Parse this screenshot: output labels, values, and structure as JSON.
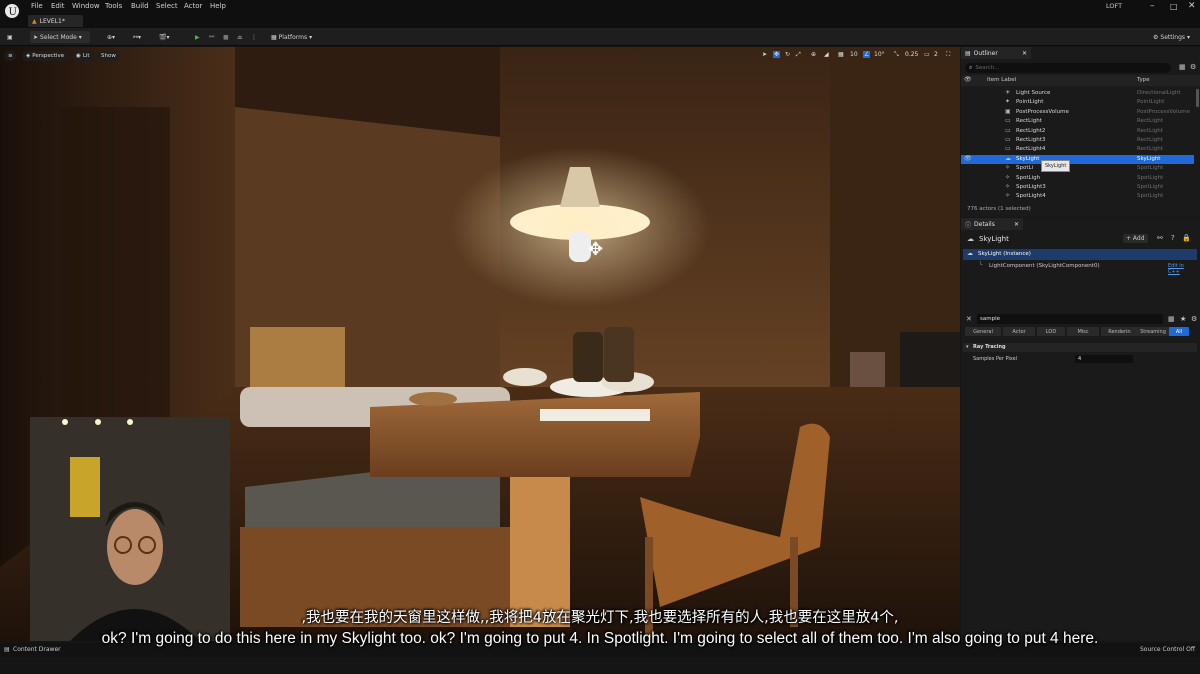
{
  "menu": [
    "File",
    "Edit",
    "Window",
    "Tools",
    "Build",
    "Select",
    "Actor",
    "Help"
  ],
  "level_tab": "LEVEL1*",
  "project_name": "LOFT",
  "toolbar": {
    "select_mode": "Select Mode",
    "platforms": "Platforms",
    "settings": "Settings"
  },
  "viewport": {
    "perspective": "Perspective",
    "lit": "Lit",
    "show": "Show",
    "grid_snap": "10",
    "angle_snap": "10°",
    "scale_snap": "0.25",
    "camera_speed": "2"
  },
  "outliner": {
    "tab": "Outliner",
    "search_placeholder": "Search...",
    "col_label": "Item Label",
    "col_type": "Type",
    "rows": [
      {
        "label": "Light Source",
        "type": "DirectionalLight",
        "icon": "sun-icon"
      },
      {
        "label": "PointLight",
        "type": "PointLight",
        "icon": "bulb-icon"
      },
      {
        "label": "PostProcessVolume",
        "type": "PostProcessVolume",
        "icon": "box-icon"
      },
      {
        "label": "RectLight",
        "type": "RectLight",
        "icon": "rect-icon"
      },
      {
        "label": "RectLight2",
        "type": "RectLight",
        "icon": "rect-icon"
      },
      {
        "label": "RectLight3",
        "type": "RectLight",
        "icon": "rect-icon"
      },
      {
        "label": "RectLight4",
        "type": "RectLight",
        "icon": "rect-icon"
      },
      {
        "label": "SkyLight",
        "type": "SkyLight",
        "icon": "sky-icon",
        "selected": true
      },
      {
        "label": "SpotLi",
        "type": "SpotLight",
        "icon": "spot-icon"
      },
      {
        "label": "SpotLigh",
        "type": "SpotLight",
        "icon": "spot-icon"
      },
      {
        "label": "SpotLight3",
        "type": "SpotLight",
        "icon": "spot-icon"
      },
      {
        "label": "SpotLight4",
        "type": "SpotLight",
        "icon": "spot-icon"
      },
      {
        "label": "SpotLight5",
        "type": "SpotLight",
        "icon": "spot-icon"
      }
    ],
    "tooltip": "SkyLight",
    "footer": "776 actors (1 selected)"
  },
  "details": {
    "tab": "Details",
    "actor_name": "SkyLight",
    "add_label": "+ Add",
    "instance_label": "SkyLight (Instance)",
    "component_label": "LightComponent (SkyLightComponent0)",
    "edit_cpp": "Edit in C++",
    "search_value": "sample",
    "filters": [
      "General",
      "Actor",
      "LOD",
      "Misc",
      "Rendering",
      "Streaming",
      "All"
    ],
    "section": "Ray Tracing",
    "property_label": "Samples Per Pixel",
    "property_value": "4"
  },
  "bottom": {
    "content_drawer": "Content Drawer",
    "source_control": "Source Control Off"
  },
  "subtitles": {
    "zh": ",我也要在我的天窗里这样做,,我将把4放在聚光灯下,我也要选择所有的人,我也要在这里放4个,",
    "en": "ok? I'm going to do this here in my Skylight too. ok? I'm going to put 4. In Spotlight. I'm going to select all of them too. I'm also going to put 4 here."
  }
}
